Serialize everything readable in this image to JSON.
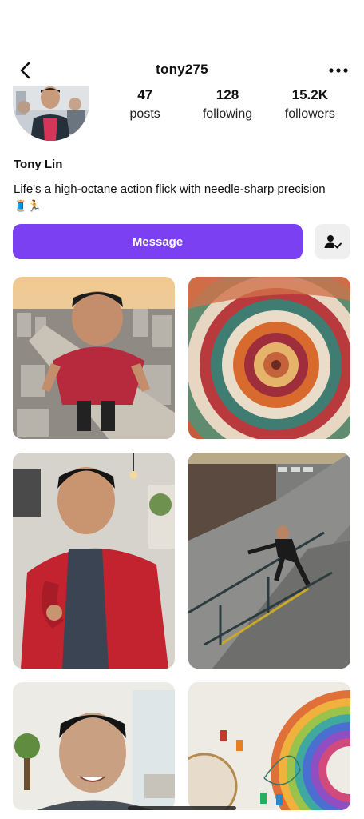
{
  "header": {
    "username": "tony275",
    "back_icon": "chevron-left-icon",
    "more_icon": "more-horizontal-icon"
  },
  "profile": {
    "display_name": "Tony Lin",
    "bio": "Life's a high-octane action flick with needle-sharp precision",
    "bio_emoji": "🧵🏃",
    "stats": [
      {
        "value": "47",
        "label": "posts"
      },
      {
        "value": "128",
        "label": "following"
      },
      {
        "value": "15.2K",
        "label": "followers"
      }
    ]
  },
  "actions": {
    "message_label": "Message",
    "follow_icon": "person-check-icon"
  },
  "colors": {
    "accent": "#7a40f2",
    "secondary_button": "#efefef"
  }
}
